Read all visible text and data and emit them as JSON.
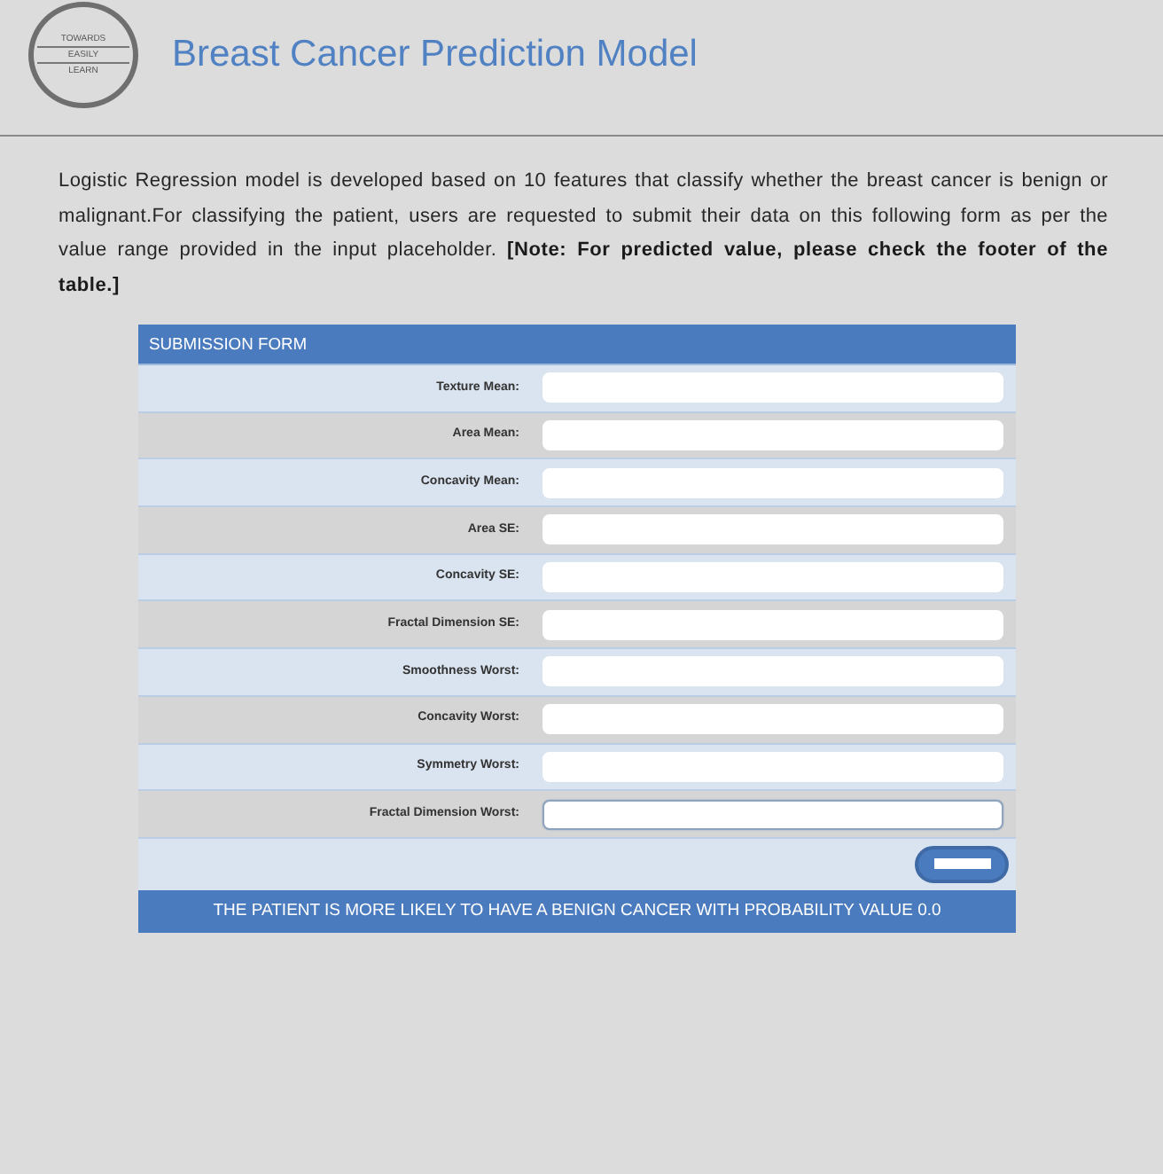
{
  "header": {
    "logo_lines": [
      "TOWARDS",
      "EASILY",
      "LEARN"
    ],
    "title": "Breast Cancer Prediction Model"
  },
  "intro": "Logistic Regression model is developed based on 10 features that classify whether the breast cancer is benign or malignant.For classifying the patient, users are requested to submit their data on this following form as per the value range provided in the input placeholder. **[Note: For predicted value, please check the footer of the table.]**",
  "form": {
    "title": "SUBMISSION FORM",
    "fields": [
      {
        "label": "Texture Mean:",
        "focused": false
      },
      {
        "label": "Area Mean:",
        "focused": false
      },
      {
        "label": "Concavity Mean:",
        "focused": false
      },
      {
        "label": "Area SE:",
        "focused": false
      },
      {
        "label": "Concavity SE:",
        "focused": false
      },
      {
        "label": "Fractal Dimension SE:",
        "focused": false
      },
      {
        "label": "Smoothness Worst:",
        "focused": false
      },
      {
        "label": "Concavity Worst:",
        "focused": false
      },
      {
        "label": "Symmetry Worst:",
        "focused": false
      },
      {
        "label": "Fractal Dimension Worst:",
        "focused": true
      }
    ],
    "result": "THE PATIENT IS MORE LIKELY TO HAVE A BENIGN CANCER WITH PROBABILITY VALUE 0.0"
  }
}
